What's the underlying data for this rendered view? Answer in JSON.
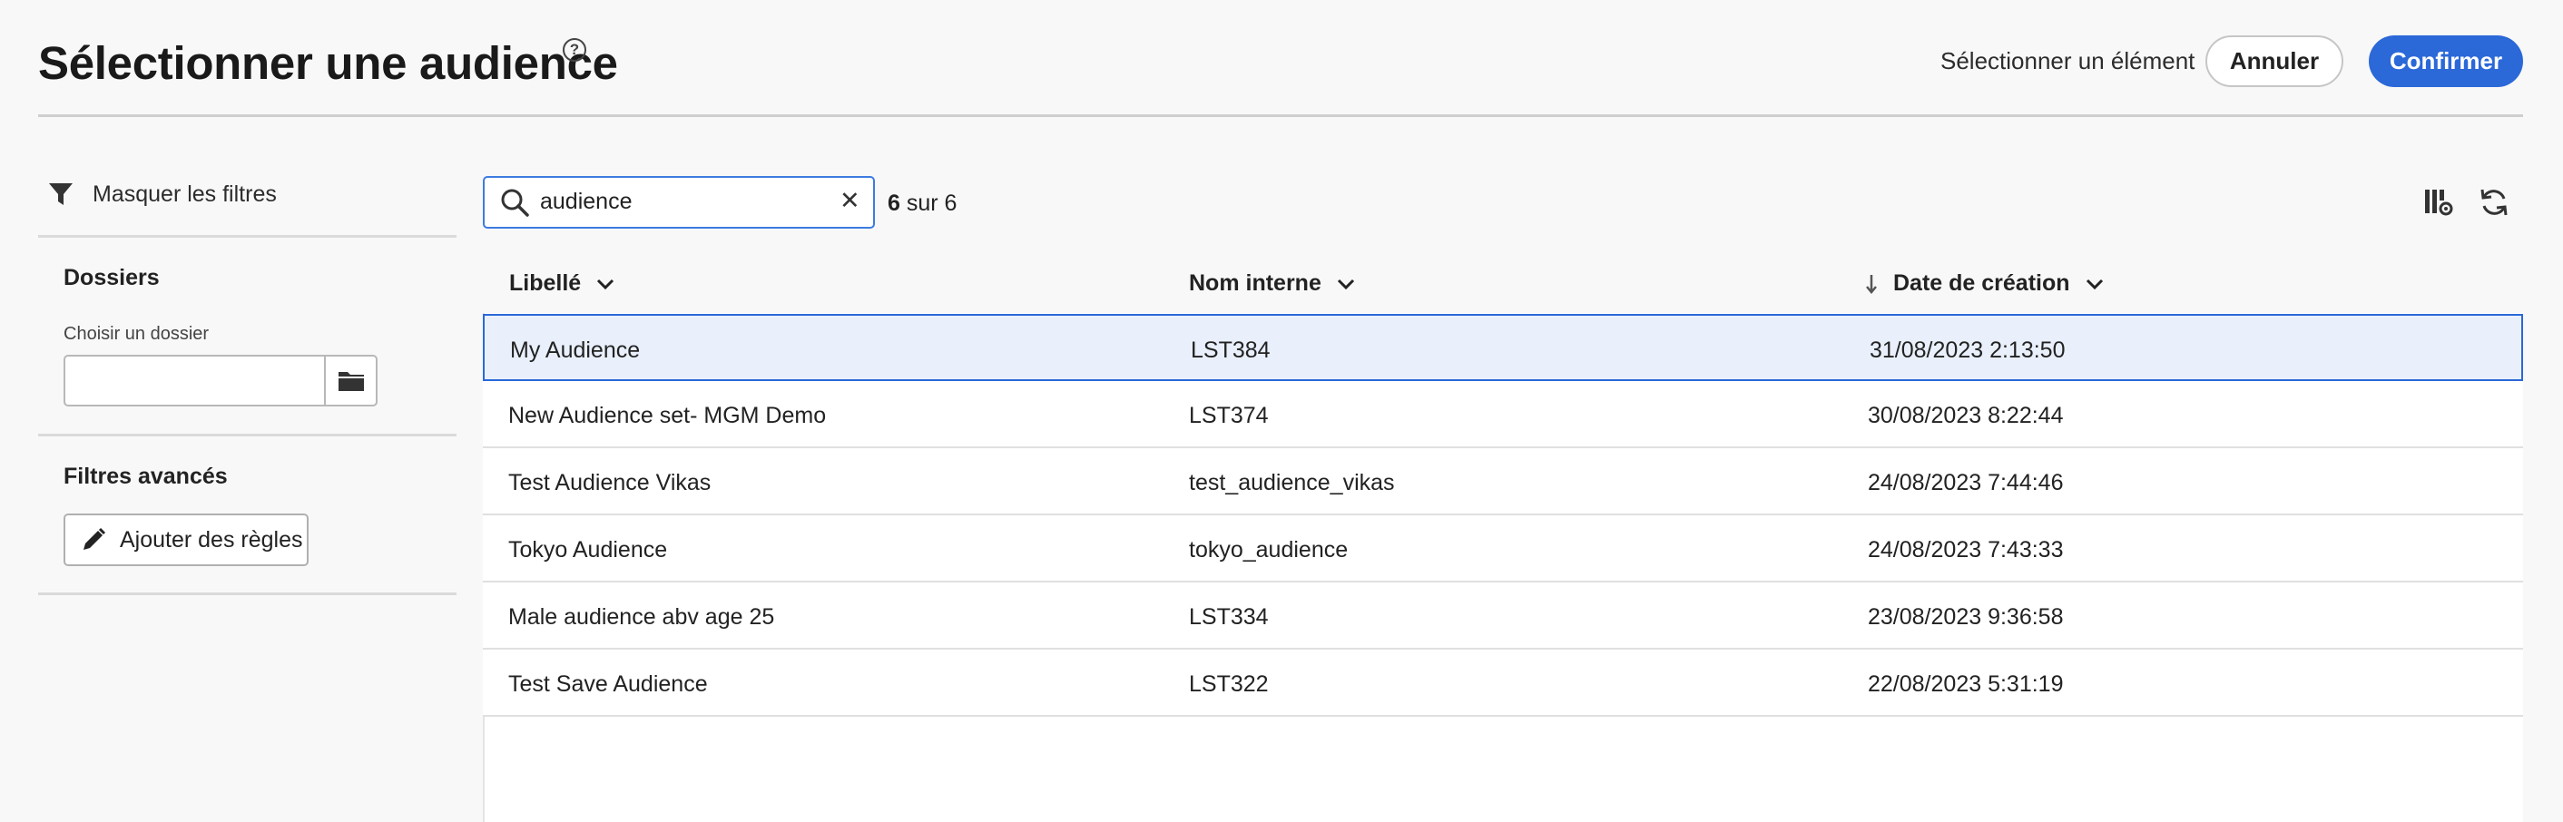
{
  "header": {
    "title": "Sélectionner une audience",
    "help_icon": "help-circle-icon",
    "select_label": "Sélectionner un élément",
    "cancel_label": "Annuler",
    "confirm_label": "Confirmer",
    "accent_color": "#2b68d8"
  },
  "sidebar": {
    "filter_toggle_label": "Masquer les filtres",
    "folders_title": "Dossiers",
    "folder_field_label": "Choisir un dossier",
    "folder_field_value": "",
    "advanced_title": "Filtres avancés",
    "add_rules_label": "Ajouter des règles"
  },
  "search": {
    "value": "audience",
    "count_shown": "6",
    "count_sep": "sur",
    "count_total": "6"
  },
  "table": {
    "columns": [
      "Libellé",
      "Nom interne",
      "Date de création"
    ],
    "sorted_column": "Date de création",
    "sort_direction": "descending",
    "rows": [
      {
        "label": "My Audience",
        "internal": "LST384",
        "date": "31/08/2023 2:13:50",
        "selected": true
      },
      {
        "label": "New Audience set- MGM Demo",
        "internal": "LST374",
        "date": "30/08/2023 8:22:44"
      },
      {
        "label": "Test Audience Vikas",
        "internal": "test_audience_vikas",
        "date": "24/08/2023 7:44:46"
      },
      {
        "label": "Tokyo Audience",
        "internal": "tokyo_audience",
        "date": "24/08/2023 7:43:33"
      },
      {
        "label": "Male audience abv age 25",
        "internal": "LST334",
        "date": "23/08/2023 9:36:58"
      },
      {
        "label": "Test Save Audience",
        "internal": "LST322",
        "date": "22/08/2023 5:31:19"
      }
    ]
  }
}
